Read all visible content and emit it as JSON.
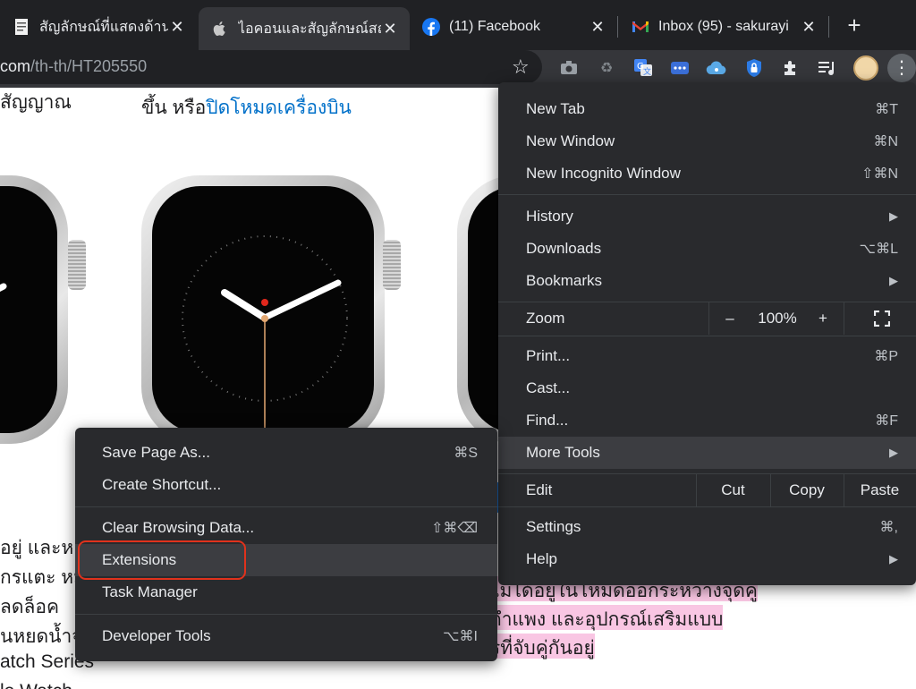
{
  "tabs": [
    {
      "title": "สัญลักษณ์ที่แสดงด้านบน",
      "icon": "document-favicon-icon",
      "active": false
    },
    {
      "title": "ไอคอนและสัญลักษณ์สถ",
      "icon": "apple-favicon-icon",
      "active": true
    },
    {
      "title": "(11) Facebook",
      "icon": "facebook-favicon-icon",
      "active": false
    },
    {
      "title": "Inbox (95) - sakurayi",
      "icon": "gmail-favicon-icon",
      "active": false
    }
  ],
  "tab_close_glyph": "✕",
  "new_tab_glyph": "+",
  "address": {
    "host": "com",
    "path": "/th-th/HT205550"
  },
  "toolbar_icons": [
    "camera-icon",
    "recycle-icon",
    "translate-icon",
    "password-icon",
    "cloud-icon",
    "lock-icon",
    "extensions-puzzle-icon",
    "media-queue-icon"
  ],
  "page": {
    "line_top_left": "สัญญาณ",
    "line_top_mid": "ขึ้น หรือ",
    "line_top_link": "ปิดโหมดเครื่องบิน",
    "left_lines": [
      "อยู่ และห",
      "กรแตะ หมู่",
      "ลดล็อค",
      "นหยดน้ำจ",
      "atch Series",
      "le Watch"
    ],
    "pink_lines": [
      "ไม่ได้อยู่ในโหมดออกระหว่างจุดคู่",
      "กำแพง และอุปกรณ์เสริมแบบ",
      "รที่จับคู่กันอยู่"
    ]
  },
  "menu": {
    "items": [
      {
        "label": "New Tab",
        "shortcut": "⌘T"
      },
      {
        "label": "New Window",
        "shortcut": "⌘N"
      },
      {
        "label": "New Incognito Window",
        "shortcut": "⇧⌘N"
      },
      {
        "label": "History",
        "shortcut": "▶"
      },
      {
        "label": "Downloads",
        "shortcut": "⌥⌘L"
      },
      {
        "label": "Bookmarks",
        "shortcut": "▶"
      },
      {
        "label": "Print...",
        "shortcut": "⌘P"
      },
      {
        "label": "Cast...",
        "shortcut": ""
      },
      {
        "label": "Find...",
        "shortcut": "⌘F"
      },
      {
        "label": "More Tools",
        "shortcut": "▶"
      },
      {
        "label": "Settings",
        "shortcut": "⌘,"
      },
      {
        "label": "Help",
        "shortcut": "▶"
      }
    ],
    "zoom": {
      "label": "Zoom",
      "minus": "–",
      "value": "100%",
      "plus": "+"
    },
    "edit": {
      "label": "Edit",
      "cut": "Cut",
      "copy": "Copy",
      "paste": "Paste"
    }
  },
  "submenu": {
    "items": [
      {
        "label": "Save Page As...",
        "shortcut": "⌘S"
      },
      {
        "label": "Create Shortcut...",
        "shortcut": ""
      },
      {
        "label": "Clear Browsing Data...",
        "shortcut": "⇧⌘⌫"
      },
      {
        "label": "Extensions",
        "shortcut": ""
      },
      {
        "label": "Task Manager",
        "shortcut": ""
      },
      {
        "label": "Developer Tools",
        "shortcut": "⌥⌘I"
      }
    ]
  },
  "colors": {
    "menu_bg": "#292a2d",
    "hover_bg": "#3c3d41",
    "highlight_ring": "#e0321c",
    "link": "#0070c9",
    "pink_highlight": "#f9c6e3"
  }
}
